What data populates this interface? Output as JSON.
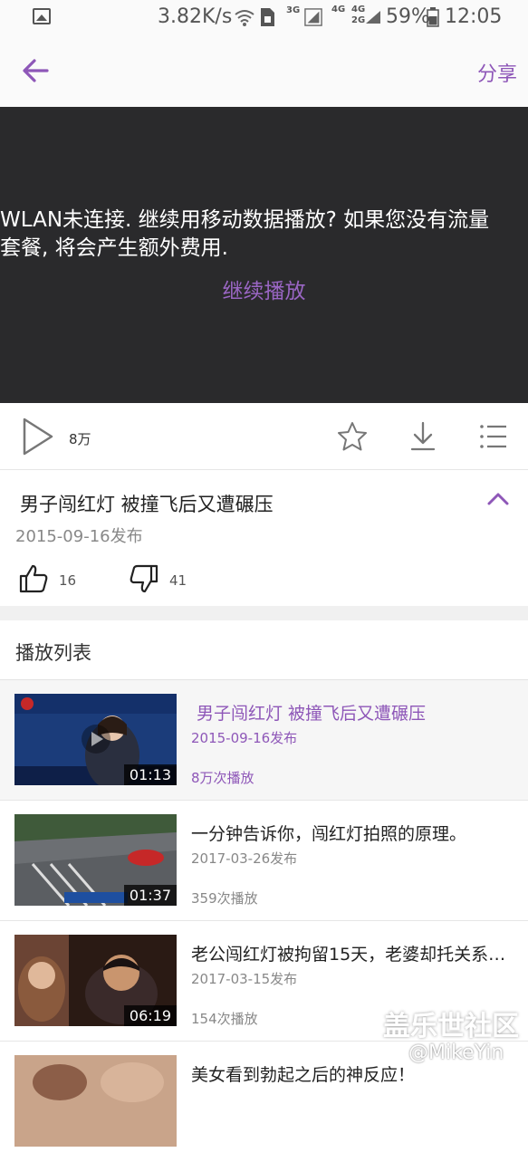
{
  "status_bar": {
    "speed": "3.82K/s",
    "net_3g": "3G",
    "net_4g": "4G",
    "net_4g2": "4G",
    "net_2g": "2G",
    "battery": "59%",
    "time": "12:05"
  },
  "appbar": {
    "share_label": "分享"
  },
  "player": {
    "message": "WLAN未连接. 继续用移动数据播放? 如果您没有流量\n套餐, 将会产生额外费用.",
    "continue_label": "继续播放"
  },
  "controls": {
    "play_count": "8万"
  },
  "video_info": {
    "title": "男子闯红灯 被撞飞后又遭碾压",
    "date": "2015-09-16发布",
    "likes": "16",
    "dislikes": "41"
  },
  "playlist": {
    "header": "播放列表",
    "items": [
      {
        "title": "男子闯红灯 被撞飞后又遭碾压",
        "date": "2015-09-16发布",
        "plays": "8万次播放",
        "duration": "01:13",
        "active": true
      },
      {
        "title": "一分钟告诉你，闯红灯拍照的原理。",
        "date": "2017-03-26发布",
        "plays": "359次播放",
        "duration": "01:37",
        "active": false
      },
      {
        "title": "老公闯红灯被拘留15天，老婆却托关系…",
        "date": "2017-03-15发布",
        "plays": "154次播放",
        "duration": "06:19",
        "active": false
      },
      {
        "title": "美女看到勃起之后的神反应！",
        "date": "",
        "plays": "",
        "duration": "",
        "active": false
      }
    ]
  },
  "watermark": {
    "line1": "盖乐世社区",
    "line2": "@MikeYin"
  },
  "colors": {
    "accent": "#8e57b8",
    "player_bg": "#2a2a2c"
  }
}
